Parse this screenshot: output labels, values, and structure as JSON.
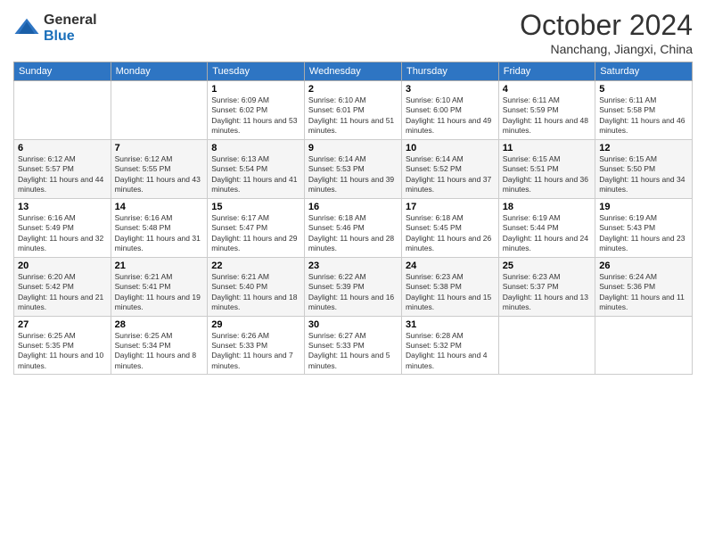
{
  "logo": {
    "general": "General",
    "blue": "Blue"
  },
  "title": "October 2024",
  "location": "Nanchang, Jiangxi, China",
  "days_of_week": [
    "Sunday",
    "Monday",
    "Tuesday",
    "Wednesday",
    "Thursday",
    "Friday",
    "Saturday"
  ],
  "weeks": [
    [
      {
        "day": "",
        "info": ""
      },
      {
        "day": "",
        "info": ""
      },
      {
        "day": "1",
        "info": "Sunrise: 6:09 AM\nSunset: 6:02 PM\nDaylight: 11 hours and 53 minutes."
      },
      {
        "day": "2",
        "info": "Sunrise: 6:10 AM\nSunset: 6:01 PM\nDaylight: 11 hours and 51 minutes."
      },
      {
        "day": "3",
        "info": "Sunrise: 6:10 AM\nSunset: 6:00 PM\nDaylight: 11 hours and 49 minutes."
      },
      {
        "day": "4",
        "info": "Sunrise: 6:11 AM\nSunset: 5:59 PM\nDaylight: 11 hours and 48 minutes."
      },
      {
        "day": "5",
        "info": "Sunrise: 6:11 AM\nSunset: 5:58 PM\nDaylight: 11 hours and 46 minutes."
      }
    ],
    [
      {
        "day": "6",
        "info": "Sunrise: 6:12 AM\nSunset: 5:57 PM\nDaylight: 11 hours and 44 minutes."
      },
      {
        "day": "7",
        "info": "Sunrise: 6:12 AM\nSunset: 5:55 PM\nDaylight: 11 hours and 43 minutes."
      },
      {
        "day": "8",
        "info": "Sunrise: 6:13 AM\nSunset: 5:54 PM\nDaylight: 11 hours and 41 minutes."
      },
      {
        "day": "9",
        "info": "Sunrise: 6:14 AM\nSunset: 5:53 PM\nDaylight: 11 hours and 39 minutes."
      },
      {
        "day": "10",
        "info": "Sunrise: 6:14 AM\nSunset: 5:52 PM\nDaylight: 11 hours and 37 minutes."
      },
      {
        "day": "11",
        "info": "Sunrise: 6:15 AM\nSunset: 5:51 PM\nDaylight: 11 hours and 36 minutes."
      },
      {
        "day": "12",
        "info": "Sunrise: 6:15 AM\nSunset: 5:50 PM\nDaylight: 11 hours and 34 minutes."
      }
    ],
    [
      {
        "day": "13",
        "info": "Sunrise: 6:16 AM\nSunset: 5:49 PM\nDaylight: 11 hours and 32 minutes."
      },
      {
        "day": "14",
        "info": "Sunrise: 6:16 AM\nSunset: 5:48 PM\nDaylight: 11 hours and 31 minutes."
      },
      {
        "day": "15",
        "info": "Sunrise: 6:17 AM\nSunset: 5:47 PM\nDaylight: 11 hours and 29 minutes."
      },
      {
        "day": "16",
        "info": "Sunrise: 6:18 AM\nSunset: 5:46 PM\nDaylight: 11 hours and 28 minutes."
      },
      {
        "day": "17",
        "info": "Sunrise: 6:18 AM\nSunset: 5:45 PM\nDaylight: 11 hours and 26 minutes."
      },
      {
        "day": "18",
        "info": "Sunrise: 6:19 AM\nSunset: 5:44 PM\nDaylight: 11 hours and 24 minutes."
      },
      {
        "day": "19",
        "info": "Sunrise: 6:19 AM\nSunset: 5:43 PM\nDaylight: 11 hours and 23 minutes."
      }
    ],
    [
      {
        "day": "20",
        "info": "Sunrise: 6:20 AM\nSunset: 5:42 PM\nDaylight: 11 hours and 21 minutes."
      },
      {
        "day": "21",
        "info": "Sunrise: 6:21 AM\nSunset: 5:41 PM\nDaylight: 11 hours and 19 minutes."
      },
      {
        "day": "22",
        "info": "Sunrise: 6:21 AM\nSunset: 5:40 PM\nDaylight: 11 hours and 18 minutes."
      },
      {
        "day": "23",
        "info": "Sunrise: 6:22 AM\nSunset: 5:39 PM\nDaylight: 11 hours and 16 minutes."
      },
      {
        "day": "24",
        "info": "Sunrise: 6:23 AM\nSunset: 5:38 PM\nDaylight: 11 hours and 15 minutes."
      },
      {
        "day": "25",
        "info": "Sunrise: 6:23 AM\nSunset: 5:37 PM\nDaylight: 11 hours and 13 minutes."
      },
      {
        "day": "26",
        "info": "Sunrise: 6:24 AM\nSunset: 5:36 PM\nDaylight: 11 hours and 11 minutes."
      }
    ],
    [
      {
        "day": "27",
        "info": "Sunrise: 6:25 AM\nSunset: 5:35 PM\nDaylight: 11 hours and 10 minutes."
      },
      {
        "day": "28",
        "info": "Sunrise: 6:25 AM\nSunset: 5:34 PM\nDaylight: 11 hours and 8 minutes."
      },
      {
        "day": "29",
        "info": "Sunrise: 6:26 AM\nSunset: 5:33 PM\nDaylight: 11 hours and 7 minutes."
      },
      {
        "day": "30",
        "info": "Sunrise: 6:27 AM\nSunset: 5:33 PM\nDaylight: 11 hours and 5 minutes."
      },
      {
        "day": "31",
        "info": "Sunrise: 6:28 AM\nSunset: 5:32 PM\nDaylight: 11 hours and 4 minutes."
      },
      {
        "day": "",
        "info": ""
      },
      {
        "day": "",
        "info": ""
      }
    ]
  ]
}
